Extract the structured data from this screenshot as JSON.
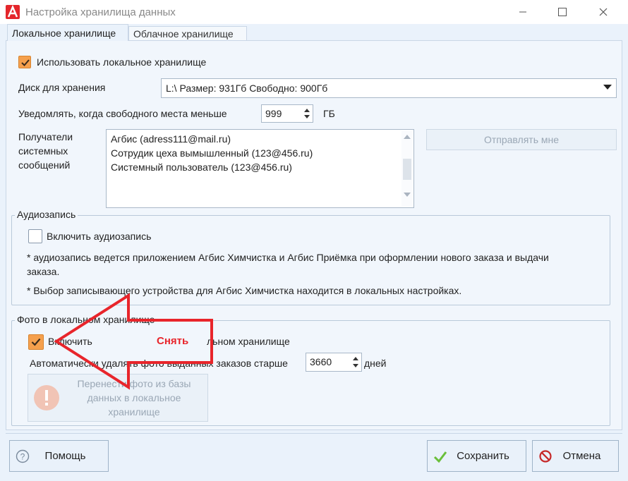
{
  "window": {
    "title": "Настройка хранилища данных"
  },
  "tabs": [
    {
      "label": "Локальное хранилище",
      "active": true
    },
    {
      "label": "Облачное хранилище",
      "active": false
    }
  ],
  "local": {
    "use_local_label": "Использовать локальное хранилище",
    "use_local_checked": true,
    "disk_label": "Диск для хранения",
    "disk_value": "L:\\ Размер: 931Гб Свободно: 900Гб",
    "notify_label": "Уведомлять, когда свободного места меньше",
    "notify_value": "999",
    "notify_unit": "ГБ",
    "recipients_label_1": "Получатели",
    "recipients_label_2": "системных",
    "recipients_label_3": "сообщений",
    "recipients": [
      "Агбис (adress111@mail.ru)",
      "Сотрудик цеха вымышленный (123@456.ru)",
      "Системный пользователь (123@456.ru)"
    ],
    "send_me_label": "Отправлять мне"
  },
  "audio": {
    "group_title": "Аудиозапись",
    "enable_label": "Включить аудиозапись",
    "enable_checked": false,
    "note1_line1": "* аудиозапись ведется приложением Агбис Химчистка и Агбис Приёмка при оформлении нового заказа и выдачи",
    "note1_line2": "заказа.",
    "note2": "* Выбор записывающего устройства для Агбис Химчистка находится в локальных настройках."
  },
  "photo": {
    "group_title": "Фото в локальном хранилище",
    "enable_label": "Включить фото в локальном хранилище",
    "enable_label_visible_left": "Включить",
    "enable_label_visible_right": "льном хранилище",
    "enable_checked": true,
    "auto_delete_label": "Автоматически удалять фото выданных заказов старше",
    "auto_delete_value": "3660",
    "auto_delete_unit": "дней",
    "move_btn_line1": "Перенести фото из базы",
    "move_btn_line2": "данных в локальное",
    "move_btn_line3": "хранилище"
  },
  "annotation": {
    "label": "Снять",
    "color": "#e8252b"
  },
  "footer": {
    "help_label": "Помощь",
    "save_label": "Сохранить",
    "cancel_label": "Отмена"
  },
  "colors": {
    "accent_checkbox": "#f5a04d",
    "arrow": "#e8252b",
    "background": "#eaf2fb"
  }
}
